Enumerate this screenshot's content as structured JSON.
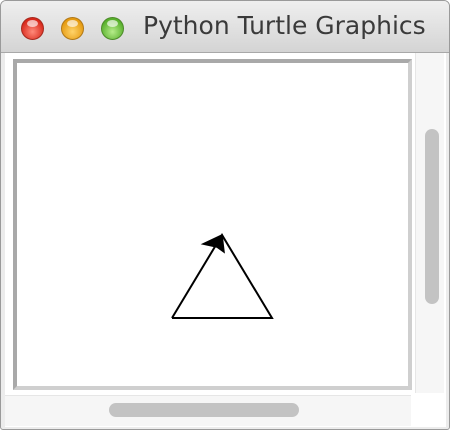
{
  "window": {
    "title": "Python Turtle Graphics",
    "controls": {
      "close_icon": "close-icon",
      "minimize_icon": "minimize-icon",
      "maximize_icon": "maximize-icon"
    }
  },
  "canvas": {
    "drawing": "triangle",
    "stroke_color": "#000000",
    "turtle": {
      "shape": "arrow",
      "color": "#000000",
      "heading": "up-right"
    }
  },
  "scrollbars": {
    "vertical": {
      "icon": "vertical-scrollbar"
    },
    "horizontal": {
      "icon": "horizontal-scrollbar"
    }
  }
}
